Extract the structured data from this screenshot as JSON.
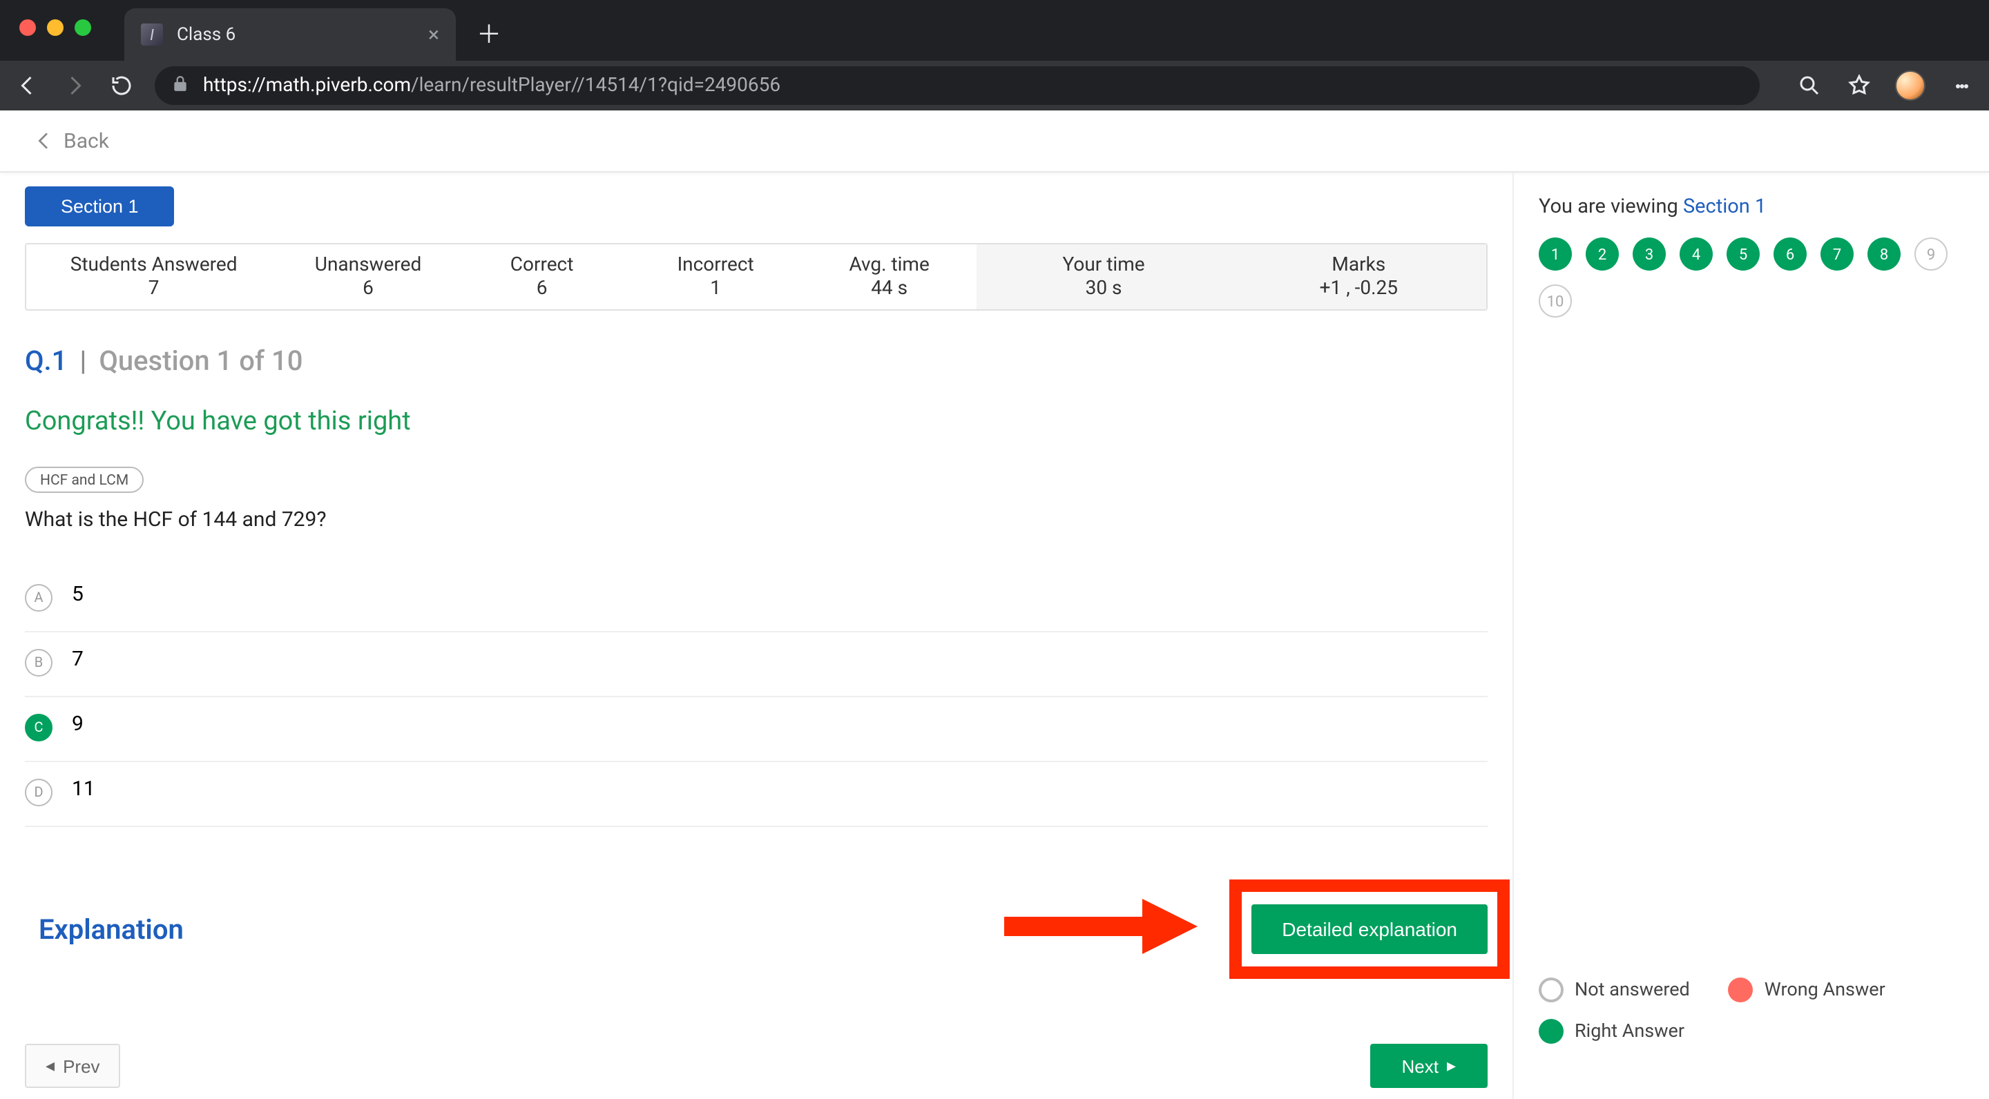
{
  "browser": {
    "tab_title": "Class 6",
    "url_host": "https://math.piverb.com",
    "url_path": "/learn/resultPlayer//14514/1?qid=2490656"
  },
  "back_label": "Back",
  "section_button": "Section 1",
  "stats": {
    "headers": [
      "Students Answered",
      "Unanswered",
      "Correct",
      "Incorrect",
      "Avg. time",
      "Your time",
      "Marks"
    ],
    "values": [
      "7",
      "6",
      "6",
      "1",
      "44 s",
      "30 s",
      "+1 ,  -0.25"
    ]
  },
  "question": {
    "number_label": "Q.1",
    "of_label": "Question 1 of 10",
    "congrats": "Congrats!! You have got this right",
    "topic_tag": "HCF and LCM",
    "text": "What is the HCF of 144 and 729?",
    "options": [
      {
        "letter": "A",
        "text": "5",
        "correct": false
      },
      {
        "letter": "B",
        "text": "7",
        "correct": false
      },
      {
        "letter": "C",
        "text": "9",
        "correct": true
      },
      {
        "letter": "D",
        "text": "11",
        "correct": false
      }
    ]
  },
  "explanation": {
    "title": "Explanation",
    "button": "Detailed explanation"
  },
  "pager": {
    "prev": "Prev",
    "next": "Next"
  },
  "sidebar": {
    "viewing_prefix": "You are viewing ",
    "viewing_link": "Section 1",
    "questions": [
      {
        "n": "1",
        "state": "right"
      },
      {
        "n": "2",
        "state": "right"
      },
      {
        "n": "3",
        "state": "right"
      },
      {
        "n": "4",
        "state": "right"
      },
      {
        "n": "5",
        "state": "right"
      },
      {
        "n": "6",
        "state": "right"
      },
      {
        "n": "7",
        "state": "right"
      },
      {
        "n": "8",
        "state": "right"
      },
      {
        "n": "9",
        "state": "na"
      },
      {
        "n": "10",
        "state": "na"
      }
    ],
    "legend": {
      "not_answered": "Not answered",
      "wrong": "Wrong Answer",
      "right": "Right Answer"
    }
  }
}
